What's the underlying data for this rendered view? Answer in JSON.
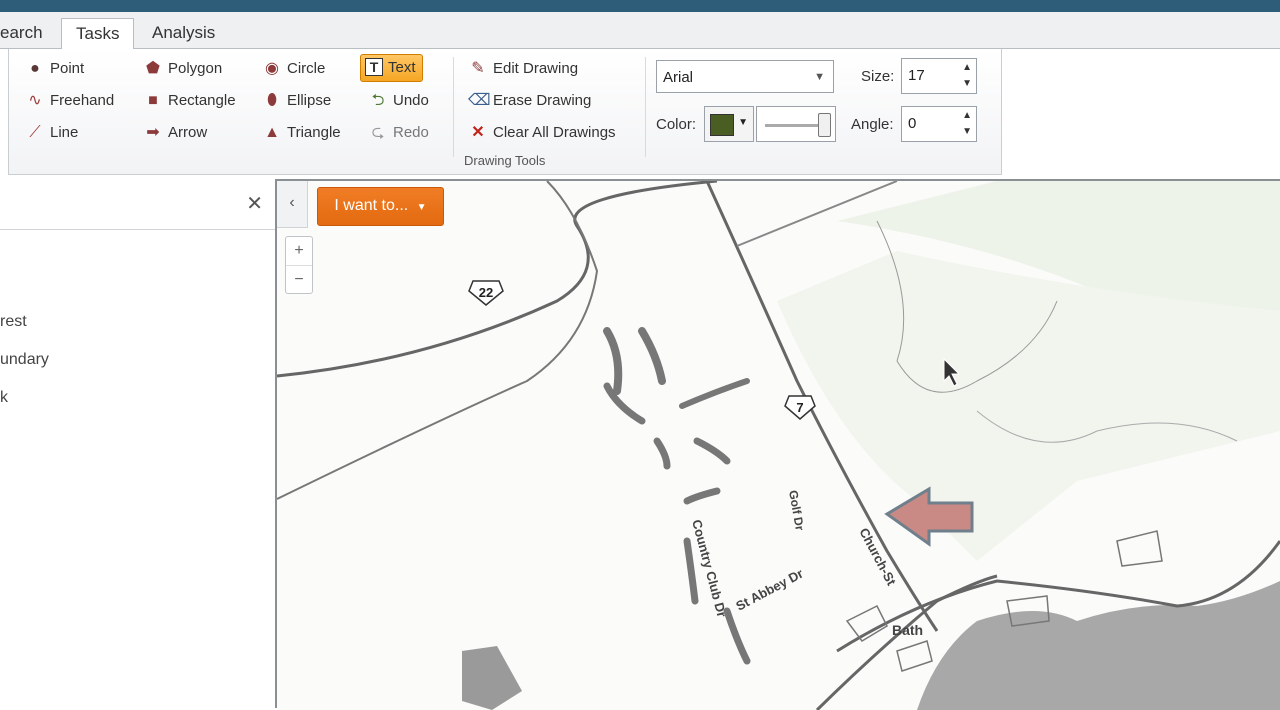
{
  "tabs": [
    {
      "label": "earch"
    },
    {
      "label": "Tasks"
    },
    {
      "label": "Analysis"
    }
  ],
  "drawing_tools": {
    "group_label": "Drawing Tools",
    "col1": [
      {
        "label": "Point",
        "icon": "point-icon"
      },
      {
        "label": "Freehand",
        "icon": "freehand-icon"
      },
      {
        "label": "Line",
        "icon": "line-icon"
      }
    ],
    "col2": [
      {
        "label": "Polygon",
        "icon": "polygon-icon"
      },
      {
        "label": "Rectangle",
        "icon": "rectangle-icon"
      },
      {
        "label": "Arrow",
        "icon": "arrow-icon"
      }
    ],
    "col3": [
      {
        "label": "Circle",
        "icon": "circle-icon"
      },
      {
        "label": "Ellipse",
        "icon": "ellipse-icon"
      },
      {
        "label": "Triangle",
        "icon": "triangle-icon"
      }
    ],
    "col4": [
      {
        "label": "Text",
        "icon": "text-icon",
        "selected": true
      },
      {
        "label": "Undo",
        "icon": "undo-icon"
      },
      {
        "label": "Redo",
        "icon": "redo-icon"
      }
    ],
    "col5": [
      {
        "label": "Edit Drawing",
        "icon": "edit-drawing-icon"
      },
      {
        "label": "Erase Drawing",
        "icon": "eraser-icon"
      },
      {
        "label": "Clear All Drawings",
        "icon": "clear-icon"
      }
    ]
  },
  "text_options": {
    "font": "Arial",
    "size_label": "Size:",
    "size_value": "17",
    "color_label": "Color:",
    "color_value": "#4a5d23",
    "angle_label": "Angle:",
    "angle_value": "0"
  },
  "left_panel": {
    "items": [
      "rest",
      "undary",
      "k"
    ]
  },
  "map": {
    "iwant_label": "I want to...",
    "labels": [
      "22",
      "7",
      "Church-St",
      "Country Club Dr",
      "St Abbey Dr",
      "Bath",
      "Golf Dr"
    ]
  },
  "colors": {
    "accent": "#f07d25",
    "topbar": "#2e5d7a",
    "drawn_arrow": "#c98a86"
  }
}
